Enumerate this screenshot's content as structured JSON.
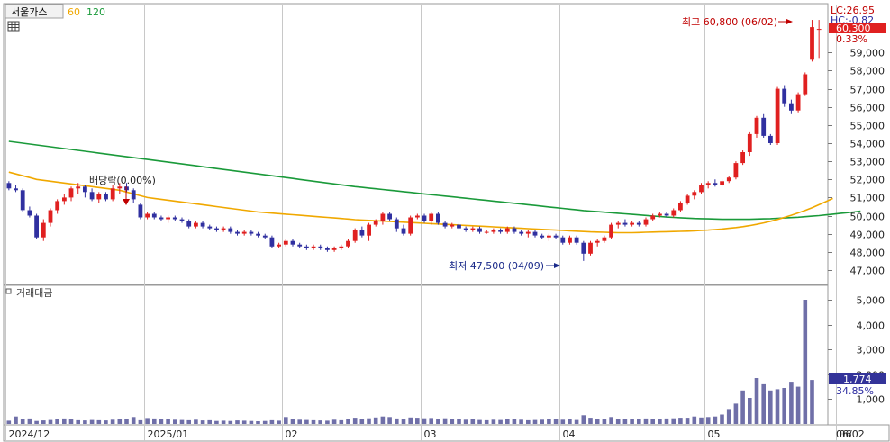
{
  "header": {
    "stock_name": "서울가스",
    "ma60_label": "60",
    "ma120_label": "120",
    "volume_title": "거래대금"
  },
  "right_panel": {
    "lc": "LC:26.95",
    "hc": "HC:-0.82",
    "price_badge": "60,300",
    "change_pct": "0.33%",
    "volume_badge": "1,774",
    "volume_pct": "34.85%"
  },
  "annotations": {
    "high": "최고 60,800 (06/02)",
    "low": "최저 47,500 (04/09)",
    "dividend": "배당락(0.00%)"
  },
  "colors": {
    "up": "#e02020",
    "down": "#3030a0",
    "ma60": "#f0a800",
    "ma120": "#1a9a3a",
    "grid": "#c8c8c8",
    "volume": "#6f6fa8",
    "badge": "#e02020",
    "badge_vol": "#333399"
  },
  "chart_data": {
    "type": "candlestick",
    "x_ticks": [
      {
        "label": "2024/12",
        "index": 0
      },
      {
        "label": "2025/01",
        "index": 20
      },
      {
        "label": "02",
        "index": 40
      },
      {
        "label": "03",
        "index": 60
      },
      {
        "label": "04",
        "index": 80
      },
      {
        "label": "05",
        "index": 101
      },
      {
        "label": "06",
        "index": 120
      },
      {
        "label": "06/02",
        "index": 127
      }
    ],
    "price_axis": {
      "min": 46500,
      "max": 61200,
      "ticks": [
        47000,
        48000,
        49000,
        50000,
        51000,
        52000,
        53000,
        54000,
        55000,
        56000,
        57000,
        58000,
        59000
      ]
    },
    "volume_axis": {
      "min": 0,
      "max": 5400,
      "ticks": [
        1000,
        2000,
        3000,
        4000,
        5000
      ]
    },
    "ohlc": [
      [
        51800,
        51900,
        51400,
        51500
      ],
      [
        51500,
        51700,
        51300,
        51400
      ],
      [
        51400,
        51500,
        50200,
        50300
      ],
      [
        50300,
        50500,
        49900,
        50000
      ],
      [
        50000,
        50100,
        48700,
        48800
      ],
      [
        48800,
        49800,
        48600,
        49600
      ],
      [
        49600,
        50400,
        49400,
        50300
      ],
      [
        50300,
        50900,
        50100,
        50800
      ],
      [
        50800,
        51200,
        50600,
        51000
      ],
      [
        51000,
        51600,
        50800,
        51500
      ],
      [
        51500,
        51800,
        51200,
        51600
      ],
      [
        51600,
        51700,
        51000,
        51300
      ],
      [
        51300,
        51500,
        50800,
        50900
      ],
      [
        50900,
        51300,
        50700,
        51200
      ],
      [
        51200,
        51300,
        50800,
        50900
      ],
      [
        50900,
        51700,
        50800,
        51500
      ],
      [
        51500,
        51800,
        51200,
        51600
      ],
      [
        51600,
        51800,
        51300,
        51400
      ],
      [
        51400,
        51500,
        50700,
        50900
      ],
      [
        50600,
        50700,
        49800,
        49900
      ],
      [
        49900,
        50200,
        49800,
        50100
      ],
      [
        50100,
        50200,
        49800,
        49900
      ],
      [
        49900,
        50000,
        49700,
        49800
      ],
      [
        49800,
        50000,
        49600,
        49900
      ],
      [
        49900,
        50000,
        49700,
        49800
      ],
      [
        49800,
        49900,
        49600,
        49700
      ],
      [
        49700,
        49800,
        49300,
        49400
      ],
      [
        49400,
        49700,
        49300,
        49600
      ],
      [
        49600,
        49700,
        49300,
        49400
      ],
      [
        49400,
        49500,
        49200,
        49300
      ],
      [
        49300,
        49400,
        49100,
        49200
      ],
      [
        49200,
        49400,
        49100,
        49300
      ],
      [
        49300,
        49400,
        49000,
        49100
      ],
      [
        49100,
        49200,
        48900,
        49000
      ],
      [
        49000,
        49200,
        48900,
        49100
      ],
      [
        49100,
        49200,
        48900,
        49000
      ],
      [
        49000,
        49100,
        48800,
        48900
      ],
      [
        48900,
        49000,
        48700,
        48800
      ],
      [
        48800,
        48900,
        48200,
        48300
      ],
      [
        48300,
        48500,
        48200,
        48400
      ],
      [
        48400,
        48700,
        48300,
        48600
      ],
      [
        48600,
        48700,
        48300,
        48400
      ],
      [
        48400,
        48500,
        48200,
        48300
      ],
      [
        48300,
        48400,
        48100,
        48200
      ],
      [
        48200,
        48400,
        48100,
        48300
      ],
      [
        48300,
        48400,
        48100,
        48200
      ],
      [
        48200,
        48300,
        48000,
        48100
      ],
      [
        48100,
        48300,
        48000,
        48200
      ],
      [
        48200,
        48400,
        48100,
        48300
      ],
      [
        48300,
        48700,
        48200,
        48600
      ],
      [
        48600,
        49300,
        48500,
        49200
      ],
      [
        49200,
        49400,
        48800,
        48900
      ],
      [
        48900,
        49600,
        48600,
        49500
      ],
      [
        49500,
        49800,
        49400,
        49700
      ],
      [
        49700,
        50200,
        49500,
        50100
      ],
      [
        50100,
        50200,
        49700,
        49800
      ],
      [
        49800,
        49900,
        49100,
        49300
      ],
      [
        49300,
        49500,
        48900,
        49000
      ],
      [
        49000,
        50000,
        48900,
        49900
      ],
      [
        49900,
        50100,
        49800,
        50000
      ],
      [
        50000,
        50100,
        49600,
        49700
      ],
      [
        49700,
        50200,
        49500,
        50100
      ],
      [
        50100,
        50200,
        49500,
        49600
      ],
      [
        49600,
        49700,
        49300,
        49400
      ],
      [
        49400,
        49600,
        49300,
        49500
      ],
      [
        49500,
        49600,
        49200,
        49300
      ],
      [
        49300,
        49400,
        49100,
        49200
      ],
      [
        49200,
        49400,
        49100,
        49300
      ],
      [
        49300,
        49400,
        49000,
        49100
      ],
      [
        49100,
        49200,
        49000,
        49100
      ],
      [
        49100,
        49300,
        49000,
        49200
      ],
      [
        49200,
        49300,
        49000,
        49100
      ],
      [
        49100,
        49400,
        49000,
        49300
      ],
      [
        49300,
        49400,
        49000,
        49100
      ],
      [
        49100,
        49200,
        48900,
        49000
      ],
      [
        49000,
        49200,
        48800,
        49100
      ],
      [
        49100,
        49200,
        48800,
        48900
      ],
      [
        48900,
        49000,
        48700,
        48800
      ],
      [
        48800,
        49000,
        48600,
        48900
      ],
      [
        48900,
        49000,
        48700,
        48800
      ],
      [
        48800,
        48900,
        48400,
        48500
      ],
      [
        48500,
        48900,
        48400,
        48800
      ],
      [
        48800,
        48900,
        48400,
        48500
      ],
      [
        48500,
        48600,
        47500,
        47900
      ],
      [
        47900,
        48600,
        47800,
        48500
      ],
      [
        48500,
        48700,
        48300,
        48600
      ],
      [
        48600,
        48900,
        48500,
        48800
      ],
      [
        48800,
        49600,
        48700,
        49500
      ],
      [
        49500,
        49700,
        49300,
        49600
      ],
      [
        49600,
        49800,
        49400,
        49500
      ],
      [
        49500,
        49700,
        49400,
        49600
      ],
      [
        49600,
        49700,
        49400,
        49500
      ],
      [
        49500,
        49900,
        49400,
        49800
      ],
      [
        49800,
        50100,
        49700,
        50000
      ],
      [
        50000,
        50200,
        49900,
        50100
      ],
      [
        50100,
        50200,
        49900,
        50000
      ],
      [
        50000,
        50400,
        49900,
        50300
      ],
      [
        50300,
        50800,
        50200,
        50700
      ],
      [
        50700,
        51200,
        50600,
        51100
      ],
      [
        51100,
        51400,
        50900,
        51300
      ],
      [
        51300,
        51800,
        51200,
        51700
      ],
      [
        51700,
        51900,
        51500,
        51800
      ],
      [
        51800,
        52000,
        51600,
        51700
      ],
      [
        51700,
        52000,
        51600,
        51900
      ],
      [
        51900,
        52200,
        51800,
        52100
      ],
      [
        52100,
        53000,
        52000,
        52900
      ],
      [
        52900,
        53600,
        52800,
        53500
      ],
      [
        53500,
        54600,
        53300,
        54500
      ],
      [
        54500,
        55500,
        54300,
        55400
      ],
      [
        55400,
        55600,
        54300,
        54400
      ],
      [
        54400,
        54500,
        53900,
        54000
      ],
      [
        54000,
        57100,
        53900,
        57000
      ],
      [
        57000,
        57200,
        56000,
        56200
      ],
      [
        56200,
        56400,
        55600,
        55800
      ],
      [
        55800,
        56800,
        55700,
        56700
      ],
      [
        56700,
        57900,
        56600,
        57800
      ],
      [
        58600,
        60800,
        58500,
        60400
      ],
      [
        60300,
        60800,
        58700,
        60300
      ]
    ],
    "ma60": [
      52400,
      52300,
      52200,
      52100,
      52000,
      51950,
      51900,
      51850,
      51800,
      51750,
      51700,
      51650,
      51600,
      51550,
      51500,
      51450,
      51400,
      51300,
      51200,
      51100,
      51000,
      50950,
      50900,
      50850,
      50800,
      50750,
      50700,
      50650,
      50600,
      50550,
      50500,
      50450,
      50400,
      50350,
      50300,
      50250,
      50200,
      50170,
      50140,
      50110,
      50080,
      50050,
      50020,
      49990,
      49960,
      49930,
      49900,
      49870,
      49840,
      49810,
      49780,
      49760,
      49740,
      49720,
      49700,
      49680,
      49660,
      49640,
      49620,
      49600,
      49580,
      49560,
      49540,
      49520,
      49500,
      49480,
      49460,
      49440,
      49420,
      49400,
      49380,
      49360,
      49340,
      49320,
      49300,
      49280,
      49260,
      49240,
      49220,
      49200,
      49180,
      49160,
      49140,
      49120,
      49100,
      49090,
      49080,
      49070,
      49060,
      49060,
      49060,
      49070,
      49080,
      49090,
      49100,
      49110,
      49120,
      49130,
      49140,
      49160,
      49180,
      49200,
      49230,
      49260,
      49300,
      49340,
      49390,
      49450,
      49520,
      49600,
      49690,
      49790,
      49900,
      50020,
      50150,
      50290,
      50440,
      50600,
      50770,
      50950
    ],
    "ma120": [
      54100,
      54050,
      54000,
      53950,
      53900,
      53850,
      53800,
      53750,
      53700,
      53650,
      53600,
      53550,
      53500,
      53450,
      53400,
      53350,
      53300,
      53250,
      53200,
      53150,
      53100,
      53050,
      53000,
      52950,
      52900,
      52850,
      52800,
      52750,
      52700,
      52650,
      52600,
      52550,
      52500,
      52450,
      52400,
      52350,
      52300,
      52250,
      52200,
      52150,
      52100,
      52050,
      52000,
      51950,
      51900,
      51850,
      51800,
      51750,
      51700,
      51650,
      51600,
      51560,
      51520,
      51480,
      51440,
      51400,
      51360,
      51320,
      51280,
      51240,
      51200,
      51160,
      51120,
      51080,
      51040,
      51000,
      50960,
      50920,
      50880,
      50840,
      50800,
      50760,
      50720,
      50680,
      50640,
      50600,
      50560,
      50520,
      50480,
      50440,
      50400,
      50360,
      50320,
      50280,
      50250,
      50220,
      50190,
      50160,
      50130,
      50100,
      50070,
      50040,
      50010,
      49980,
      49950,
      49920,
      49900,
      49880,
      49860,
      49840,
      49830,
      49820,
      49810,
      49800,
      49800,
      49800,
      49800,
      49800,
      49810,
      49820,
      49830,
      49850,
      49870,
      49890,
      49910,
      49940,
      49970,
      50000,
      50040,
      50080,
      50120,
      50160,
      50200,
      50250
    ],
    "volume": [
      130,
      300,
      180,
      220,
      120,
      140,
      160,
      200,
      220,
      180,
      150,
      140,
      160,
      150,
      140,
      170,
      180,
      200,
      280,
      150,
      240,
      220,
      200,
      180,
      170,
      160,
      150,
      170,
      140,
      150,
      120,
      130,
      120,
      140,
      130,
      120,
      110,
      120,
      150,
      130,
      280,
      200,
      170,
      160,
      150,
      140,
      130,
      170,
      150,
      180,
      250,
      210,
      230,
      260,
      300,
      280,
      220,
      210,
      260,
      250,
      230,
      240,
      200,
      230,
      190,
      180,
      170,
      180,
      160,
      150,
      170,
      160,
      190,
      180,
      170,
      150,
      160,
      170,
      180,
      180,
      170,
      200,
      160,
      350,
      250,
      200,
      180,
      280,
      210,
      190,
      200,
      180,
      220,
      210,
      200,
      220,
      230,
      250,
      250,
      300,
      260,
      280,
      300,
      380,
      600,
      820,
      1350,
      1050,
      1850,
      1600,
      1350,
      1400,
      1450,
      1700,
      1500,
      5000,
      1774
    ]
  }
}
